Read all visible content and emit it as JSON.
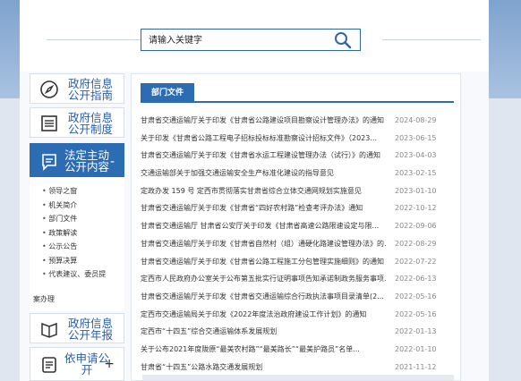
{
  "search": {
    "placeholder": "请输入关键字",
    "icon": "search-icon"
  },
  "sidebar": {
    "items": [
      {
        "label": "政府信息\n公开指南",
        "icon": "compass-icon"
      },
      {
        "label": "政府信息\n公开制度",
        "icon": "document-list-icon"
      },
      {
        "label": "法定主动\n公开内容",
        "icon": "chat-doc-icon",
        "toggle": "-"
      },
      {
        "label": "政府信息\n公开年报",
        "icon": "book-icon"
      },
      {
        "label": "依申请公\n开",
        "icon": "form-icon",
        "toggle": "+"
      }
    ],
    "subitems": [
      "领导之窗",
      "机关简介",
      "部门文件",
      "政策解读",
      "公示公告",
      "预算决算",
      "代表建议、委员提",
      "案办理"
    ]
  },
  "main": {
    "tab": "部门文件",
    "rows": [
      {
        "title": "甘肃省交通运输厅关于印发《甘肃省公路建设项目勘察设计管理办法》的通知",
        "date": "2024-08-29"
      },
      {
        "title": "关于印发《甘肃省公路工程电子招标投标标准勘察设计招标文件》（2023...",
        "date": "2023-06-15"
      },
      {
        "title": "甘肃省交通运输厅关于印发《甘肃省水运工程建设管理办法（试行）》的通知",
        "date": "2023-04-03"
      },
      {
        "title": "交通运输部关于加强交通运输安全生产标准化建设的指导意见",
        "date": "2023-02-15"
      },
      {
        "title": "定政办发 159 号 定西市贯彻落实甘肃省综合立体交通网规划实施意见",
        "date": "2023-01-10"
      },
      {
        "title": "甘肃省交通运输厅关于印发《甘肃省“四好农村路”检查考评办法》通知",
        "date": "2022-10-12"
      },
      {
        "title": "甘肃省交通运输厅 甘肃省公安厅关于印发《甘肃省高速公路限速设定与限...",
        "date": "2022-09-06"
      },
      {
        "title": "甘肃省交通运输厅关于印发《甘肃省自然村（组）通硬化路建设管理办法》的...",
        "date": "2022-08-29"
      },
      {
        "title": "甘肃省交通运输厅关于印发《甘肃省公路工程施工分包管理实施细则》的通知",
        "date": "2022-07-22"
      },
      {
        "title": "定西市人民政府办公室关于公布第五批实行证明事项告知承诺制政务服务事项...",
        "date": "2022-06-13"
      },
      {
        "title": "甘肃省交通运输厅关于印发《甘肃省交通运输综合行政执法事项目录清单(2...",
        "date": "2022-05-16"
      },
      {
        "title": "定西市交通运输局关于印发《2022年度法治政府建设工作计划》的通知",
        "date": "2022-05-16"
      },
      {
        "title": "定西市“十四五”综合交通运输体系发展规划",
        "date": "2022-01-13"
      },
      {
        "title": "关于公布2021年度陇原“最美农村路”“最美路长”“最美护路员”名单...",
        "date": "2022-01-10"
      },
      {
        "title": "甘肃省“十四五”公路水路交通发展规划",
        "date": "2021-11-12"
      }
    ]
  },
  "colors": {
    "accent": "#2b6cb3",
    "banner": "#7fa3cf"
  }
}
